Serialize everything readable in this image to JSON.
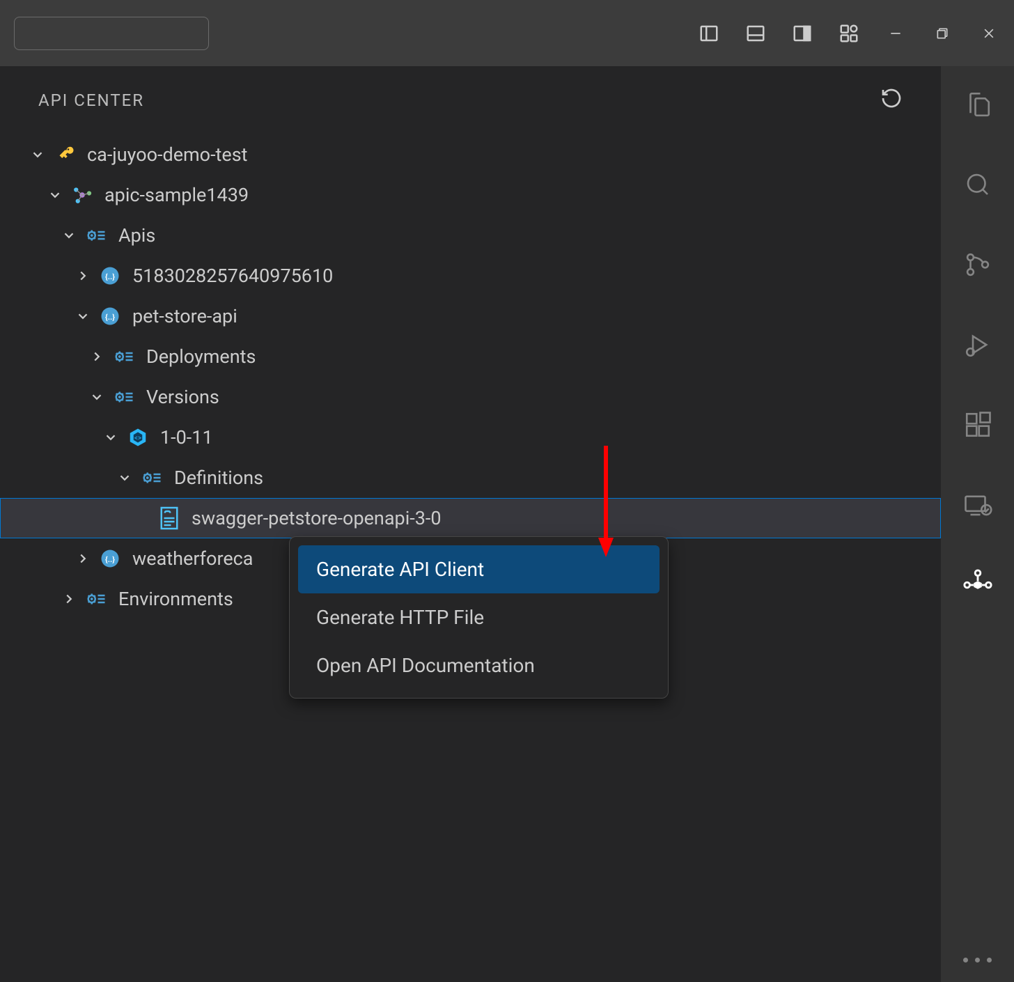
{
  "panel": {
    "title": "API CENTER"
  },
  "tree": {
    "root": "ca-juyoo-demo-test",
    "sample": "apic-sample1439",
    "apis": "Apis",
    "api1": "5183028257640975610",
    "api2": "pet-store-api",
    "deployments": "Deployments",
    "versions": "Versions",
    "version1": "1-0-11",
    "definitions": "Definitions",
    "def1": "swagger-petstore-openapi-3-0",
    "api3": "weatherforeca",
    "environments": "Environments"
  },
  "contextMenu": {
    "item1": "Generate API Client",
    "item2": "Generate HTTP File",
    "item3": "Open API Documentation"
  }
}
